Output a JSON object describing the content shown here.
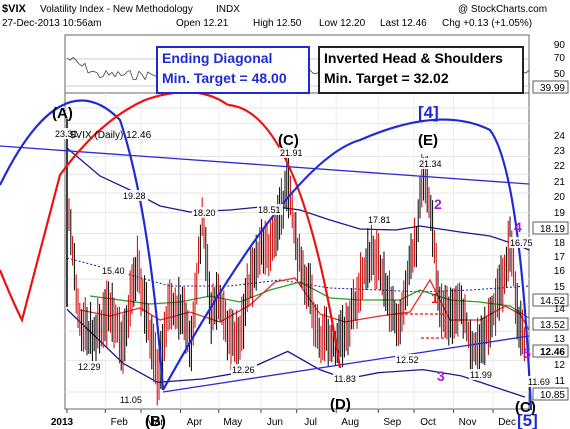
{
  "header": {
    "symbol": "$VIX",
    "name": "Volatility Index - New Methodology",
    "exchange": "INDX",
    "source": "@ StockCharts.com",
    "datetime": "27-Dec-2013 10:56am",
    "open": "Open 12.21",
    "high": "High 12.50",
    "low": "Low 12.20",
    "last": "Last 12.46",
    "change": "Chg +0.13 (+1.05%)",
    "legend": "$VIX (Daily) 12.46"
  },
  "annotations": {
    "box_left_title": "Ending Diagonal",
    "box_left_target": "Min. Target = 48.00",
    "box_right_title": "Inverted Head & Shoulders",
    "box_right_target": "Min. Target = 32.02",
    "waves": [
      "(A)",
      "(B)",
      "(C)",
      "(D)",
      "(E)",
      "[4]",
      "[5]",
      "(C)"
    ],
    "sub_waves": [
      "1",
      "2",
      "3",
      "4",
      "5"
    ]
  },
  "colors": {
    "price": "#000000",
    "up_bar": "#cc0000",
    "ma_green": "#2f9e2f",
    "ma_red": "#e03030",
    "bands": "#1a1a8c",
    "trendline": "#2b2bd6",
    "arc_blue": "#1f2ad6",
    "arc_red": "#ee1111",
    "support_red": "#ee1111",
    "purple": "#a31ad6"
  },
  "chart_data": {
    "type": "line",
    "title": "$VIX Volatility Index - New Methodology INDX",
    "xlabel": "",
    "ylabel": "",
    "x_ticks": [
      "2013",
      "Feb",
      "Mar",
      "Apr",
      "May",
      "Jun",
      "Jul",
      "Aug",
      "Sep",
      "Oct",
      "Nov",
      "Dec"
    ],
    "y_ticks": [
      11,
      12,
      13,
      14,
      15,
      16,
      17,
      18,
      19,
      20,
      21,
      22,
      23,
      24
    ],
    "ylim": [
      10.5,
      25
    ],
    "grid": true,
    "series": [
      {
        "name": "$VIX (Daily)",
        "x": [
          "2013-01-02",
          "2013-01-03",
          "2013-01-10",
          "2013-01-18",
          "2013-01-25",
          "2013-02-05",
          "2013-02-15",
          "2013-02-26",
          "2013-03-05",
          "2013-03-14",
          "2013-03-22",
          "2013-04-01",
          "2013-04-10",
          "2013-04-18",
          "2013-04-25",
          "2013-05-02",
          "2013-05-10",
          "2013-05-17",
          "2013-05-24",
          "2013-06-03",
          "2013-06-10",
          "2013-06-17",
          "2013-06-24",
          "2013-07-01",
          "2013-07-10",
          "2013-07-19",
          "2013-07-26",
          "2013-08-02",
          "2013-08-09",
          "2013-08-16",
          "2013-08-26",
          "2013-09-03",
          "2013-09-10",
          "2013-09-19",
          "2013-09-26",
          "2013-10-03",
          "2013-10-08",
          "2013-10-14",
          "2013-10-22",
          "2013-10-30",
          "2013-11-07",
          "2013-11-15",
          "2013-11-22",
          "2013-12-02",
          "2013-12-10",
          "2013-12-16",
          "2013-12-20",
          "2013-12-27"
        ],
        "values": [
          22.7,
          18.4,
          13.6,
          12.7,
          12.9,
          13.7,
          12.5,
          15.4,
          13.5,
          11.3,
          13.6,
          13.8,
          12.5,
          17.6,
          13.6,
          13.9,
          12.6,
          12.5,
          14.4,
          16.3,
          15.9,
          17.2,
          19.5,
          16.2,
          14.5,
          12.5,
          12.8,
          12.3,
          12.9,
          13.9,
          15.9,
          15.6,
          14.1,
          13.2,
          14.9,
          16.7,
          20.3,
          17.9,
          13.4,
          13.6,
          13.9,
          12.4,
          12.3,
          13.6,
          14.9,
          16.7,
          13.8,
          12.46
        ]
      },
      {
        "name": "Lower band",
        "x": [
          "2013-01-02",
          "2013-02-15",
          "2013-03-14",
          "2013-04-18",
          "2013-05-17",
          "2013-06-03",
          "2013-06-24",
          "2013-07-19",
          "2013-08-09",
          "2013-09-03",
          "2013-10-08",
          "2013-11-07",
          "2013-12-27"
        ],
        "values": [
          13.8,
          11.9,
          11.3,
          11.4,
          11.6,
          11.9,
          12.3,
          11.7,
          11.4,
          11.6,
          11.7,
          11.5,
          10.85
        ]
      }
    ],
    "price_labels": [
      "23.31",
      "19.28",
      "18.20",
      "18.51",
      "21.91",
      "17.81",
      "21.34",
      "16.75",
      "15.40",
      "12.29",
      "11.05",
      "12.26",
      "11.83",
      "12.52",
      "11.99",
      "11.69"
    ],
    "axis_labels": [
      "90",
      "70",
      "50",
      "30",
      "39.99",
      "24",
      "23",
      "22",
      "21",
      "20",
      "19",
      "18.19",
      "18",
      "17",
      "16",
      "15",
      "14.52",
      "14",
      "13.52",
      "13",
      "12.46",
      "12",
      "11",
      "10.85"
    ]
  }
}
